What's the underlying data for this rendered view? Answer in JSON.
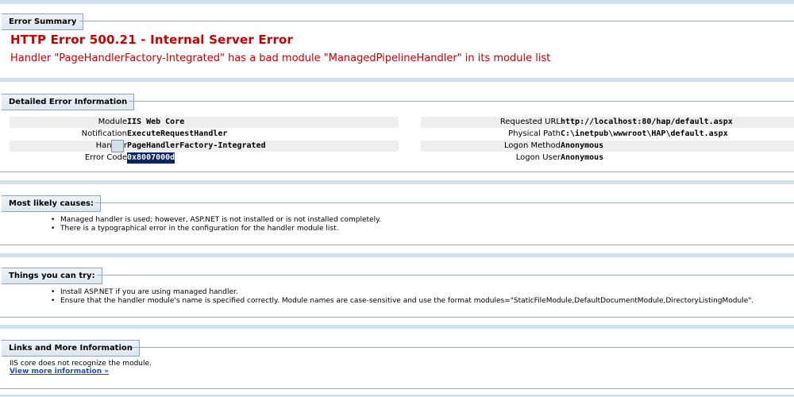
{
  "error_summary": {
    "header": "Error Summary",
    "title": "HTTP Error 500.21 - Internal Server Error",
    "message": "Handler \"PageHandlerFactory-Integrated\" has a bad module \"ManagedPipelineHandler\" in its module list"
  },
  "details": {
    "header": "Detailed Error Information",
    "left": [
      {
        "label": "Module",
        "value": "IIS Web Core"
      },
      {
        "label": "Notification",
        "value": "ExecuteRequestHandler"
      },
      {
        "label": "Handler",
        "value": "PageHandlerFactory-Integrated"
      },
      {
        "label": "Error Code",
        "value": "0x8007000d"
      }
    ],
    "right": [
      {
        "label": "Requested URL",
        "value": "http://localhost:80/hap/default.aspx"
      },
      {
        "label": "Physical Path",
        "value": "C:\\inetpub\\wwwroot\\HAP\\default.aspx"
      },
      {
        "label": "Logon Method",
        "value": "Anonymous"
      },
      {
        "label": "Logon User",
        "value": "Anonymous"
      }
    ]
  },
  "causes": {
    "header": "Most likely causes:",
    "items": [
      "Managed handler is used; however, ASP.NET is not installed or is not installed completely.",
      "There is a typographical error in the configuration for the handler module list."
    ]
  },
  "try": {
    "header": "Things you can try:",
    "items": [
      "Install ASP.NET if you are using managed handler.",
      "Ensure that the handler module's name is specified correctly. Module names are case-sensitive and use the format modules=\"StaticFileModule,DefaultDocumentModule,DirectoryListingModule\"."
    ]
  },
  "links": {
    "header": "Links and More Information",
    "text": "IIS core does not recognize the module.",
    "link": "View more information »"
  },
  "colors": {
    "error_red": "#cc0000",
    "separator": "#cfe0ee",
    "link": "#1155bb",
    "selection": "#0a246a"
  }
}
